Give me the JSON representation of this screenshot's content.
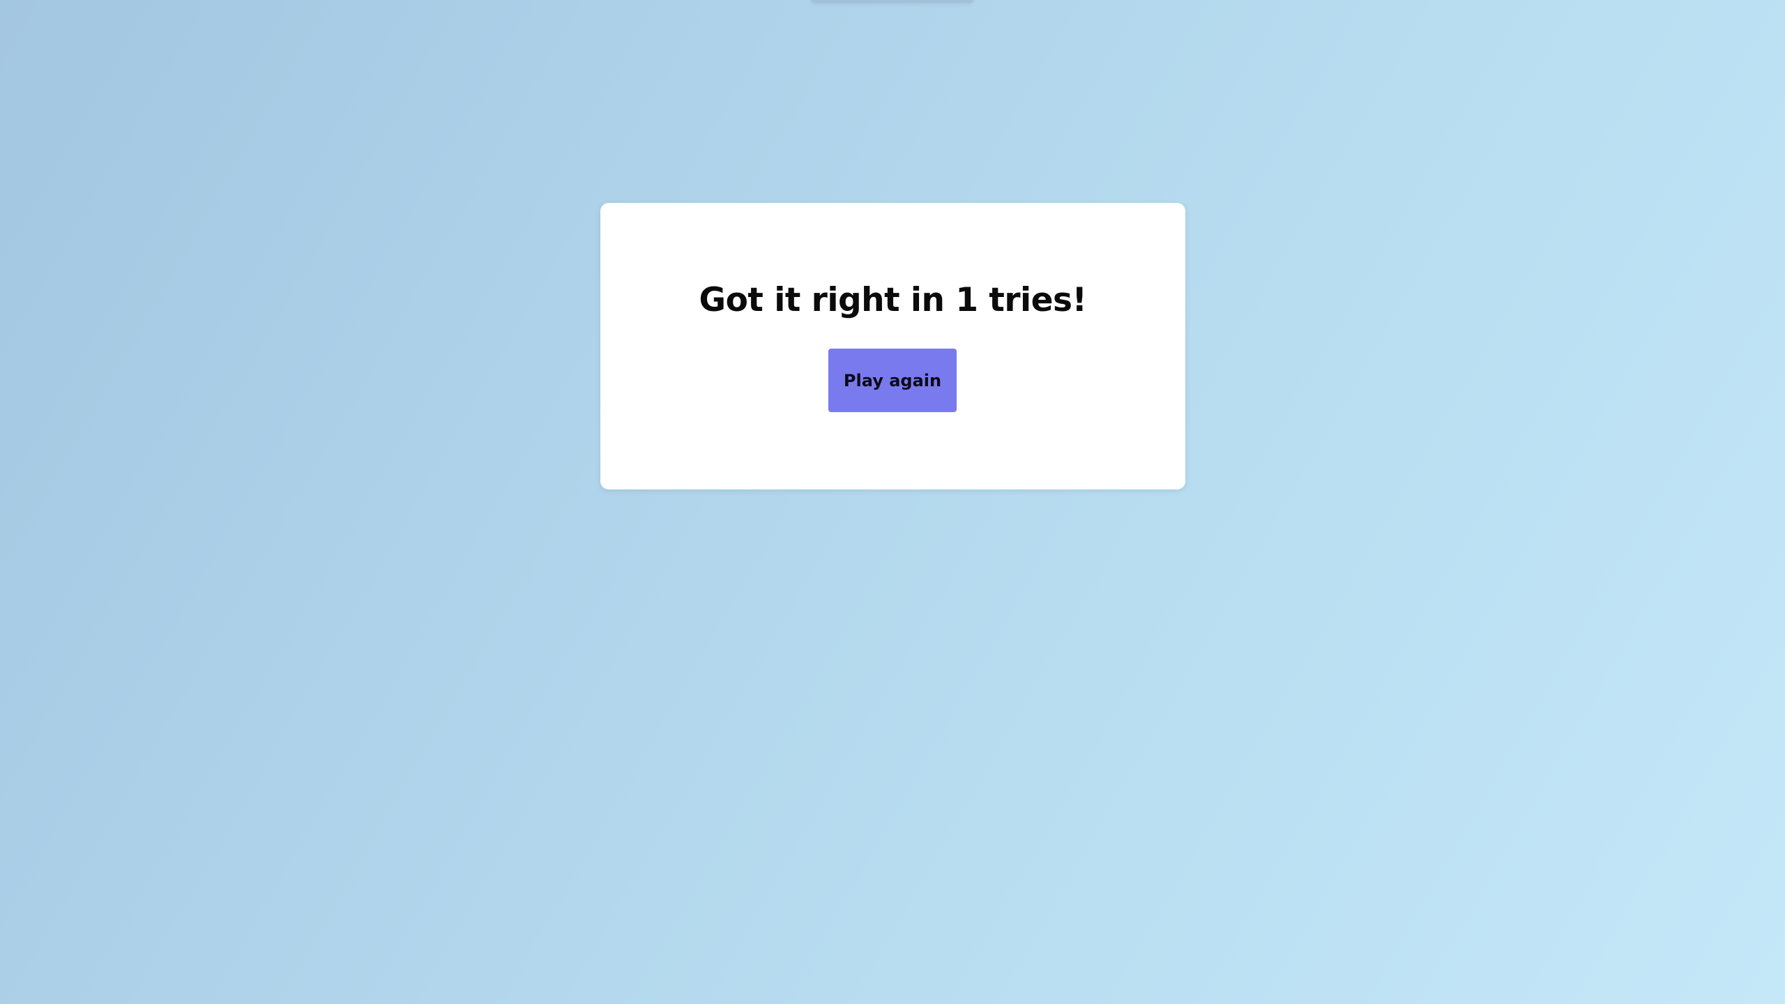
{
  "result": {
    "heading": "Got it right in 1 tries!",
    "play_again_label": "Play again"
  },
  "colors": {
    "background_start": "#a3c6e1",
    "background_end": "#c4e8f8",
    "card": "#ffffff",
    "button": "#7a7aef",
    "text": "#0b0b0b"
  }
}
